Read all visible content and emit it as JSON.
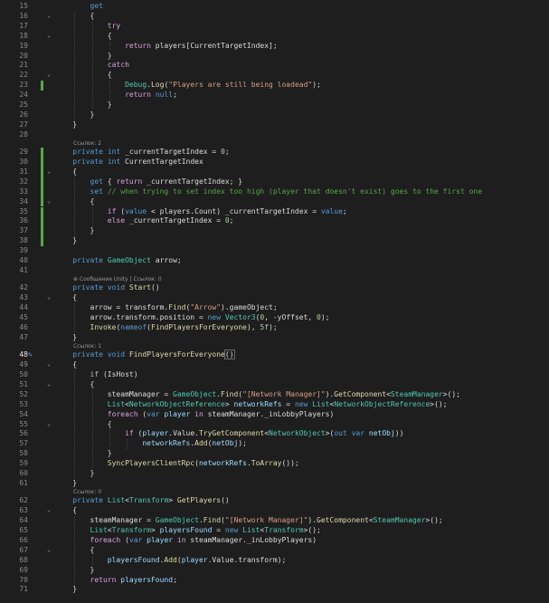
{
  "editor": {
    "current_line": 48,
    "changed_lines": [
      23,
      29,
      30,
      31,
      32,
      33,
      34,
      35,
      36,
      37,
      38
    ],
    "lines": [
      {
        "n": 15,
        "tokens": [
          {
            "t": "        "
          },
          {
            "t": "get",
            "c": "k"
          }
        ]
      },
      {
        "n": 16,
        "tokens": [
          {
            "t": "        {"
          }
        ]
      },
      {
        "n": 17,
        "tokens": [
          {
            "t": "            "
          },
          {
            "t": "try",
            "c": "c"
          }
        ]
      },
      {
        "n": 18,
        "tokens": [
          {
            "t": "            {"
          }
        ]
      },
      {
        "n": 19,
        "tokens": [
          {
            "t": "                "
          },
          {
            "t": "return",
            "c": "c"
          },
          {
            "t": " players[CurrentTargetIndex];"
          }
        ]
      },
      {
        "n": 20,
        "tokens": [
          {
            "t": "            }"
          }
        ]
      },
      {
        "n": 21,
        "tokens": [
          {
            "t": "            "
          },
          {
            "t": "catch",
            "c": "c"
          }
        ]
      },
      {
        "n": 22,
        "tokens": [
          {
            "t": "            {"
          }
        ]
      },
      {
        "n": 23,
        "tokens": [
          {
            "t": "                "
          },
          {
            "t": "Debug",
            "c": "t"
          },
          {
            "t": "."
          },
          {
            "t": "Log",
            "c": "m"
          },
          {
            "t": "("
          },
          {
            "t": "\"Players are still being loadead\"",
            "c": "s"
          },
          {
            "t": ");"
          }
        ]
      },
      {
        "n": 24,
        "tokens": [
          {
            "t": "                "
          },
          {
            "t": "return",
            "c": "c"
          },
          {
            "t": " "
          },
          {
            "t": "null",
            "c": "k"
          },
          {
            "t": ";"
          }
        ]
      },
      {
        "n": 25,
        "tokens": [
          {
            "t": "            }"
          }
        ]
      },
      {
        "n": 26,
        "tokens": [
          {
            "t": "        }"
          }
        ]
      },
      {
        "n": 27,
        "tokens": [
          {
            "t": "    }"
          }
        ]
      },
      {
        "n": 28,
        "tokens": []
      },
      {
        "n": 29,
        "tokens": [
          {
            "t": "    "
          },
          {
            "t": "private",
            "c": "k"
          },
          {
            "t": " "
          },
          {
            "t": "int",
            "c": "k"
          },
          {
            "t": " _currentTargetIndex = "
          },
          {
            "t": "0",
            "c": "n"
          },
          {
            "t": ";"
          }
        ],
        "lens": "Ссылок: 2"
      },
      {
        "n": 30,
        "tokens": [
          {
            "t": "    "
          },
          {
            "t": "private",
            "c": "k"
          },
          {
            "t": " "
          },
          {
            "t": "int",
            "c": "k"
          },
          {
            "t": " CurrentTargetIndex"
          }
        ]
      },
      {
        "n": 31,
        "tokens": [
          {
            "t": "    {"
          }
        ]
      },
      {
        "n": 32,
        "tokens": [
          {
            "t": "        "
          },
          {
            "t": "get",
            "c": "k"
          },
          {
            "t": " { "
          },
          {
            "t": "return",
            "c": "c"
          },
          {
            "t": " _currentTargetIndex; }"
          }
        ]
      },
      {
        "n": 33,
        "tokens": [
          {
            "t": "        "
          },
          {
            "t": "set",
            "c": "k"
          },
          {
            "t": " "
          },
          {
            "t": "// when trying to set index too high (player that doesn't exist) goes to the first one",
            "c": "cm"
          }
        ]
      },
      {
        "n": 34,
        "tokens": [
          {
            "t": "        {"
          }
        ]
      },
      {
        "n": 35,
        "tokens": [
          {
            "t": "            "
          },
          {
            "t": "if",
            "c": "c"
          },
          {
            "t": " ("
          },
          {
            "t": "value",
            "c": "k"
          },
          {
            "t": " < players.Count) _currentTargetIndex = "
          },
          {
            "t": "value",
            "c": "k"
          },
          {
            "t": ";"
          }
        ]
      },
      {
        "n": 36,
        "tokens": [
          {
            "t": "            "
          },
          {
            "t": "else",
            "c": "c"
          },
          {
            "t": " _currentTargetIndex = "
          },
          {
            "t": "0",
            "c": "n"
          },
          {
            "t": ";"
          }
        ]
      },
      {
        "n": 37,
        "tokens": [
          {
            "t": "        }"
          }
        ]
      },
      {
        "n": 38,
        "tokens": [
          {
            "t": "    }"
          }
        ]
      },
      {
        "n": 39,
        "tokens": []
      },
      {
        "n": 40,
        "tokens": [
          {
            "t": "    "
          },
          {
            "t": "private",
            "c": "k"
          },
          {
            "t": " "
          },
          {
            "t": "GameObject",
            "c": "t"
          },
          {
            "t": " arrow;"
          }
        ]
      },
      {
        "n": 41,
        "tokens": []
      },
      {
        "n": 42,
        "tokens": [
          {
            "t": "    "
          },
          {
            "t": "private",
            "c": "k"
          },
          {
            "t": " "
          },
          {
            "t": "void",
            "c": "k"
          },
          {
            "t": " "
          },
          {
            "t": "Start",
            "c": "m"
          },
          {
            "t": "()"
          }
        ],
        "lens": "⊕ Сообщение Unity | Ссылок: 0"
      },
      {
        "n": 43,
        "tokens": [
          {
            "t": "    {"
          }
        ]
      },
      {
        "n": 44,
        "tokens": [
          {
            "t": "        arrow = transform."
          },
          {
            "t": "Find",
            "c": "m"
          },
          {
            "t": "("
          },
          {
            "t": "\"Arrow\"",
            "c": "s"
          },
          {
            "t": ").gameObject;"
          }
        ]
      },
      {
        "n": 45,
        "tokens": [
          {
            "t": "        arrow.transform.position = "
          },
          {
            "t": "new",
            "c": "k"
          },
          {
            "t": " "
          },
          {
            "t": "Vector3",
            "c": "t"
          },
          {
            "t": "("
          },
          {
            "t": "0",
            "c": "n"
          },
          {
            "t": ", -yOffset, "
          },
          {
            "t": "0",
            "c": "n"
          },
          {
            "t": ");"
          }
        ]
      },
      {
        "n": 46,
        "tokens": [
          {
            "t": "        "
          },
          {
            "t": "Invoke",
            "c": "m"
          },
          {
            "t": "("
          },
          {
            "t": "nameof",
            "c": "k"
          },
          {
            "t": "("
          },
          {
            "t": "FindPlayersForEveryone",
            "c": "m"
          },
          {
            "t": "), "
          },
          {
            "t": "5f",
            "c": "n"
          },
          {
            "t": ");"
          }
        ]
      },
      {
        "n": 47,
        "tokens": [
          {
            "t": "    }"
          }
        ]
      },
      {
        "n": 48,
        "tokens": [
          {
            "t": "    "
          },
          {
            "t": "private",
            "c": "k"
          },
          {
            "t": " "
          },
          {
            "t": "void",
            "c": "k"
          },
          {
            "t": " "
          },
          {
            "t": "FindPlayersForEveryone",
            "c": "m"
          },
          {
            "t": "()",
            "c": "sel"
          }
        ],
        "lens": "Ссылок: 1"
      },
      {
        "n": 49,
        "tokens": [
          {
            "t": "    {"
          }
        ]
      },
      {
        "n": 50,
        "tokens": [
          {
            "t": "        "
          },
          {
            "t": "if",
            "c": "c"
          },
          {
            "t": " (IsHost)"
          }
        ]
      },
      {
        "n": 51,
        "tokens": [
          {
            "t": "        {"
          }
        ]
      },
      {
        "n": 52,
        "tokens": [
          {
            "t": "            steamManager = "
          },
          {
            "t": "GameObject",
            "c": "t"
          },
          {
            "t": "."
          },
          {
            "t": "Find",
            "c": "m"
          },
          {
            "t": "("
          },
          {
            "t": "\"[Network Manager]\"",
            "c": "s"
          },
          {
            "t": ")."
          },
          {
            "t": "GetComponent",
            "c": "m"
          },
          {
            "t": "<"
          },
          {
            "t": "SteamManager",
            "c": "t"
          },
          {
            "t": ">();"
          }
        ]
      },
      {
        "n": 53,
        "tokens": [
          {
            "t": "            "
          },
          {
            "t": "List",
            "c": "t"
          },
          {
            "t": "<"
          },
          {
            "t": "NetworkObjectReference",
            "c": "t"
          },
          {
            "t": "> "
          },
          {
            "t": "networkRefs",
            "c": "v"
          },
          {
            "t": " = "
          },
          {
            "t": "new",
            "c": "k"
          },
          {
            "t": " "
          },
          {
            "t": "List",
            "c": "t"
          },
          {
            "t": "<"
          },
          {
            "t": "NetworkObjectReference",
            "c": "t"
          },
          {
            "t": ">();"
          }
        ]
      },
      {
        "n": 54,
        "tokens": [
          {
            "t": "            "
          },
          {
            "t": "foreach",
            "c": "c"
          },
          {
            "t": " ("
          },
          {
            "t": "var",
            "c": "k"
          },
          {
            "t": " "
          },
          {
            "t": "player",
            "c": "v"
          },
          {
            "t": " "
          },
          {
            "t": "in",
            "c": "c"
          },
          {
            "t": " steamManager._inLobbyPlayers)"
          }
        ]
      },
      {
        "n": 55,
        "tokens": [
          {
            "t": "            {"
          }
        ]
      },
      {
        "n": 56,
        "tokens": [
          {
            "t": "                "
          },
          {
            "t": "if",
            "c": "c"
          },
          {
            "t": " ("
          },
          {
            "t": "player",
            "c": "v"
          },
          {
            "t": ".Value."
          },
          {
            "t": "TryGetComponent",
            "c": "m"
          },
          {
            "t": "<"
          },
          {
            "t": "NetworkObject",
            "c": "t"
          },
          {
            "t": ">("
          },
          {
            "t": "out",
            "c": "k"
          },
          {
            "t": " "
          },
          {
            "t": "var",
            "c": "k"
          },
          {
            "t": " "
          },
          {
            "t": "netObj",
            "c": "v"
          },
          {
            "t": "))"
          }
        ]
      },
      {
        "n": 57,
        "tokens": [
          {
            "t": "                    "
          },
          {
            "t": "networkRefs",
            "c": "v"
          },
          {
            "t": "."
          },
          {
            "t": "Add",
            "c": "m"
          },
          {
            "t": "("
          },
          {
            "t": "netObj",
            "c": "v"
          },
          {
            "t": ");"
          }
        ]
      },
      {
        "n": 58,
        "tokens": [
          {
            "t": "            }"
          }
        ]
      },
      {
        "n": 59,
        "tokens": [
          {
            "t": "            "
          },
          {
            "t": "SyncPlayersClientRpc",
            "c": "m"
          },
          {
            "t": "("
          },
          {
            "t": "networkRefs",
            "c": "v"
          },
          {
            "t": "."
          },
          {
            "t": "ToArray",
            "c": "m"
          },
          {
            "t": "());"
          }
        ]
      },
      {
        "n": 60,
        "tokens": [
          {
            "t": "        }"
          }
        ]
      },
      {
        "n": 61,
        "tokens": [
          {
            "t": "    }"
          }
        ]
      },
      {
        "n": 62,
        "tokens": [
          {
            "t": "    "
          },
          {
            "t": "private",
            "c": "k"
          },
          {
            "t": " "
          },
          {
            "t": "List",
            "c": "t"
          },
          {
            "t": "<"
          },
          {
            "t": "Transform",
            "c": "t"
          },
          {
            "t": "> "
          },
          {
            "t": "GetPlayers",
            "c": "m"
          },
          {
            "t": "()"
          }
        ],
        "lens": "Ссылок: 0"
      },
      {
        "n": 63,
        "tokens": [
          {
            "t": "    {"
          }
        ]
      },
      {
        "n": 64,
        "tokens": [
          {
            "t": "        steamManager = "
          },
          {
            "t": "GameObject",
            "c": "t"
          },
          {
            "t": "."
          },
          {
            "t": "Find",
            "c": "m"
          },
          {
            "t": "("
          },
          {
            "t": "\"[Network Manager]\"",
            "c": "s"
          },
          {
            "t": ")."
          },
          {
            "t": "GetComponent",
            "c": "m"
          },
          {
            "t": "<"
          },
          {
            "t": "SteamManager",
            "c": "t"
          },
          {
            "t": ">();"
          }
        ]
      },
      {
        "n": 65,
        "tokens": [
          {
            "t": "        "
          },
          {
            "t": "List",
            "c": "t"
          },
          {
            "t": "<"
          },
          {
            "t": "Transform",
            "c": "t"
          },
          {
            "t": "> "
          },
          {
            "t": "playersFound",
            "c": "v"
          },
          {
            "t": " = "
          },
          {
            "t": "new",
            "c": "k"
          },
          {
            "t": " "
          },
          {
            "t": "List",
            "c": "t"
          },
          {
            "t": "<"
          },
          {
            "t": "Transform",
            "c": "t"
          },
          {
            "t": ">();"
          }
        ]
      },
      {
        "n": 66,
        "tokens": [
          {
            "t": "        "
          },
          {
            "t": "foreach",
            "c": "c"
          },
          {
            "t": " ("
          },
          {
            "t": "var",
            "c": "k"
          },
          {
            "t": " "
          },
          {
            "t": "player",
            "c": "v"
          },
          {
            "t": " "
          },
          {
            "t": "in",
            "c": "c"
          },
          {
            "t": " steamManager._inLobbyPlayers)"
          }
        ]
      },
      {
        "n": 67,
        "tokens": [
          {
            "t": "        {"
          }
        ]
      },
      {
        "n": 68,
        "tokens": [
          {
            "t": "            "
          },
          {
            "t": "playersFound",
            "c": "v"
          },
          {
            "t": "."
          },
          {
            "t": "Add",
            "c": "m"
          },
          {
            "t": "("
          },
          {
            "t": "player",
            "c": "v"
          },
          {
            "t": ".Value.transform);"
          }
        ]
      },
      {
        "n": 69,
        "tokens": [
          {
            "t": "        }"
          }
        ]
      },
      {
        "n": 70,
        "tokens": [
          {
            "t": "        "
          },
          {
            "t": "return",
            "c": "c"
          },
          {
            "t": " "
          },
          {
            "t": "playersFound",
            "c": "v"
          },
          {
            "t": ";"
          }
        ]
      },
      {
        "n": 71,
        "tokens": [
          {
            "t": "    }"
          }
        ]
      }
    ]
  }
}
